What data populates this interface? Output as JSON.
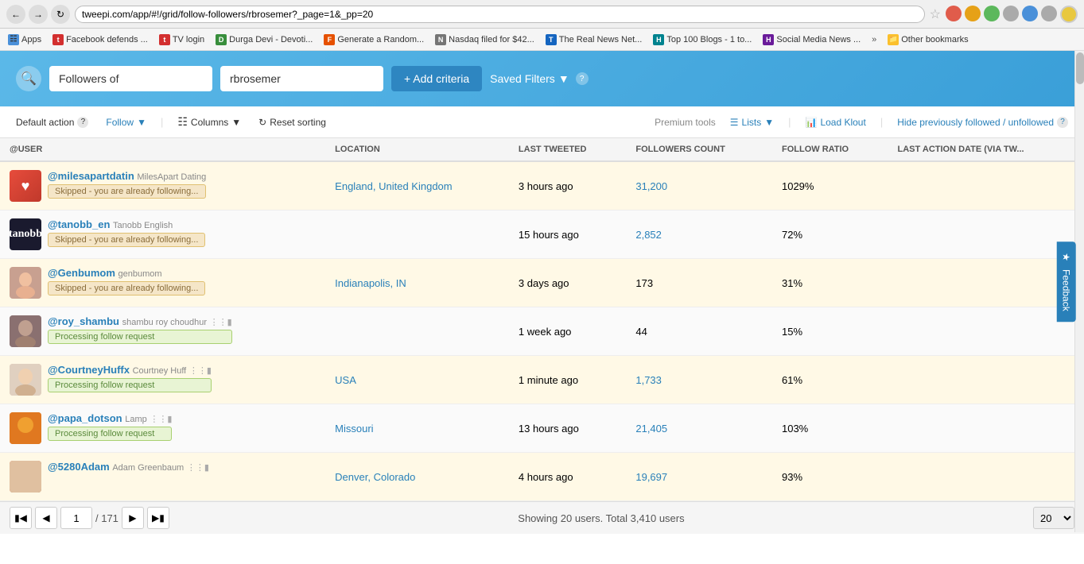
{
  "browser": {
    "url": "tweepi.com/app/#!/grid/follow-followers/rbrosemer?_page=1&_pp=20",
    "bookmarks": [
      {
        "label": "Apps",
        "icon": "apps",
        "color": "apps"
      },
      {
        "label": "Facebook defends ...",
        "icon": "roi",
        "color": "red"
      },
      {
        "label": "TV login",
        "icon": "roi",
        "color": "red"
      },
      {
        "label": "Durga Devi - Devoti...",
        "icon": "d",
        "color": "green"
      },
      {
        "label": "Generate a Random...",
        "icon": "f",
        "color": "orange"
      },
      {
        "label": "Nasdaq filed for $42...",
        "icon": "n",
        "color": "gray"
      },
      {
        "label": "The Real News Net...",
        "icon": "t",
        "color": "blue"
      },
      {
        "label": "Top 100 Blogs - 1 to...",
        "icon": "h",
        "color": "teal"
      },
      {
        "label": "Social Media News ...",
        "icon": "h",
        "color": "purple"
      },
      {
        "label": "Other bookmarks",
        "icon": "folder",
        "color": "folder"
      }
    ]
  },
  "header": {
    "filter_tag": "Followers of",
    "filter_value": "rbrosemer",
    "add_criteria_label": "+ Add criteria",
    "saved_filters_label": "Saved Filters"
  },
  "toolbar": {
    "default_action_label": "Default action",
    "follow_label": "Follow",
    "columns_label": "Columns",
    "reset_sorting_label": "Reset sorting",
    "premium_tools_label": "Premium tools",
    "lists_label": "Lists",
    "load_klout_label": "Load Klout",
    "hide_followed_label": "Hide previously followed / unfollowed"
  },
  "table": {
    "columns": [
      "@USER",
      "LOCATION",
      "LAST TWEETED",
      "FOLLOWERS COUNT",
      "FOLLOW RATIO",
      "LAST ACTION DATE (VIA TW..."
    ],
    "rows": [
      {
        "handle": "@milesapartdatin",
        "display": "MilesApart Dating",
        "location": "England, United Kingdom",
        "last_tweeted": "3 hours ago",
        "followers_count": "31,200",
        "follow_ratio": "1029%",
        "last_action": "",
        "status": "Skipped - you are already following...",
        "status_type": "skipped",
        "avatar_type": "red",
        "highlighted": true
      },
      {
        "handle": "@tanobb_en",
        "display": "Tanobb English",
        "location": "",
        "last_tweeted": "15 hours ago",
        "followers_count": "2,852",
        "follow_ratio": "72%",
        "last_action": "",
        "status": "Skipped - you are already following...",
        "status_type": "skipped",
        "avatar_type": "dark",
        "highlighted": false
      },
      {
        "handle": "@Genbumom",
        "display": "genbumom",
        "location": "Indianapolis, IN",
        "last_tweeted": "3 days ago",
        "followers_count": "173",
        "follow_ratio": "31%",
        "last_action": "",
        "status": "Skipped - you are already following...",
        "status_type": "skipped",
        "avatar_type": "face1",
        "highlighted": true
      },
      {
        "handle": "@roy_shambu",
        "display": "shambu roy choudhur",
        "location": "",
        "last_tweeted": "1 week ago",
        "followers_count": "44",
        "follow_ratio": "15%",
        "last_action": "",
        "status": "Processing follow request",
        "status_type": "processing",
        "avatar_type": "face2",
        "highlighted": false
      },
      {
        "handle": "@CourtneyHuffx",
        "display": "Courtney Huff",
        "location": "USA",
        "last_tweeted": "1 minute ago",
        "followers_count": "1,733",
        "follow_ratio": "61%",
        "last_action": "",
        "status": "Processing follow request",
        "status_type": "processing",
        "avatar_type": "face3",
        "highlighted": true
      },
      {
        "handle": "@papa_dotson",
        "display": "Lamp",
        "location": "Missouri",
        "last_tweeted": "13 hours ago",
        "followers_count": "21,405",
        "follow_ratio": "103%",
        "last_action": "",
        "status": "Processing follow request",
        "status_type": "processing",
        "avatar_type": "orange",
        "highlighted": false
      },
      {
        "handle": "@5280Adam",
        "display": "Adam Greenbaum",
        "location": "Denver, Colorado",
        "last_tweeted": "4 hours ago",
        "followers_count": "19,697",
        "follow_ratio": "93%",
        "last_action": "",
        "status": "",
        "status_type": "",
        "avatar_type": "multi",
        "highlighted": true
      }
    ]
  },
  "footer": {
    "current_page": "1",
    "total_pages": "/ 171",
    "showing_info": "Showing 20 users. Total 3,410 users",
    "per_page": "20"
  },
  "feedback": {
    "label": "Feedback"
  }
}
